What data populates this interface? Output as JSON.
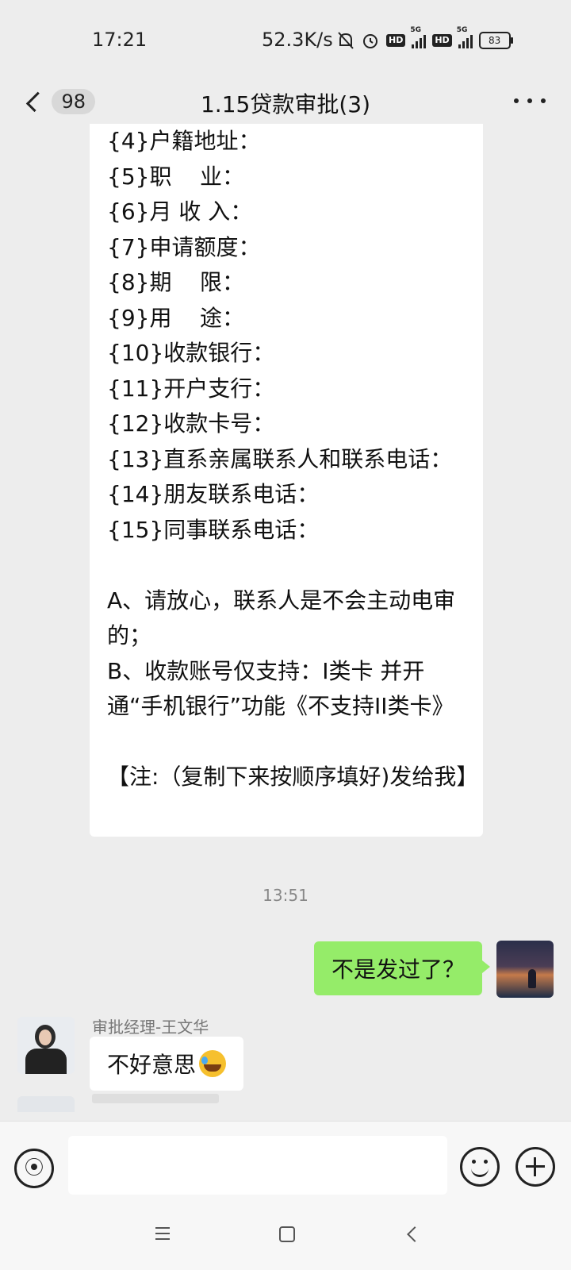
{
  "status": {
    "time": "17:21",
    "net_speed": "52.3K/s",
    "hd1": "HD",
    "hd2": "HD",
    "signal_tag1": "5G",
    "signal_tag2": "5G",
    "battery": "83"
  },
  "header": {
    "unread_count": "98",
    "title": "1.15贷款审批(3)"
  },
  "messages": {
    "form_lines": [
      "{4}户籍地址：",
      "{5}职    业：",
      "{6}月 收 入：",
      "{7}申请额度：",
      "{8}期    限：",
      "{9}用    途：",
      "{10}收款银行：",
      "{11}开户支行：",
      "{12}收款卡号：",
      "{13}直系亲属联系人和联系电话：",
      "{14}朋友联系电话：",
      "{15}同事联系电话："
    ],
    "note_a": "A、请放心，联系人是不会主动电审的；",
    "note_b": "B、收款账号仅支持：I类卡 并开通“手机银行”功能《不支持II类卡》",
    "footer_note": "【注:（复制下来按顺序填好)发给我】",
    "time_separator": "13:51",
    "my_message": "不是发过了？",
    "sender_name": "审批经理-王文华",
    "reply": "不好意思"
  },
  "icons": {
    "back": "chevron-left-icon",
    "more": "more-dots-icon",
    "voice": "voice-icon",
    "emoji": "emoji-icon",
    "plus": "plus-icon"
  },
  "colors": {
    "background": "#ededed",
    "outgoing_bubble": "#95ec69",
    "incoming_bubble": "#ffffff"
  }
}
